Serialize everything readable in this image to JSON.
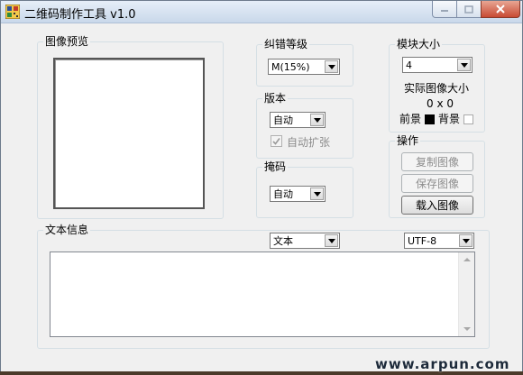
{
  "window": {
    "title": "二维码制作工具 v1.0"
  },
  "preview": {
    "label": "图像预览"
  },
  "error_correction": {
    "label": "纠错等级",
    "value": "M(15%)"
  },
  "version": {
    "label": "版本",
    "value": "自动",
    "auto_expand_label": "自动扩张",
    "auto_expand_checked": true
  },
  "mask": {
    "label": "掩码",
    "value": "自动"
  },
  "module_size": {
    "label": "模块大小",
    "value": "4",
    "actual_size_label": "实际图像大小",
    "actual_size_value": "0 x 0",
    "foreground_label": "前景",
    "foreground_color": "#000000",
    "background_label": "背景",
    "background_color": "#ffffff"
  },
  "operations": {
    "label": "操作",
    "copy_label": "复制图像",
    "save_label": "保存图像",
    "load_label": "载入图像"
  },
  "text_info": {
    "label": "文本信息",
    "type_value": "文本",
    "encoding_value": "UTF-8",
    "content": ""
  },
  "watermark": "www.arpun.com"
}
